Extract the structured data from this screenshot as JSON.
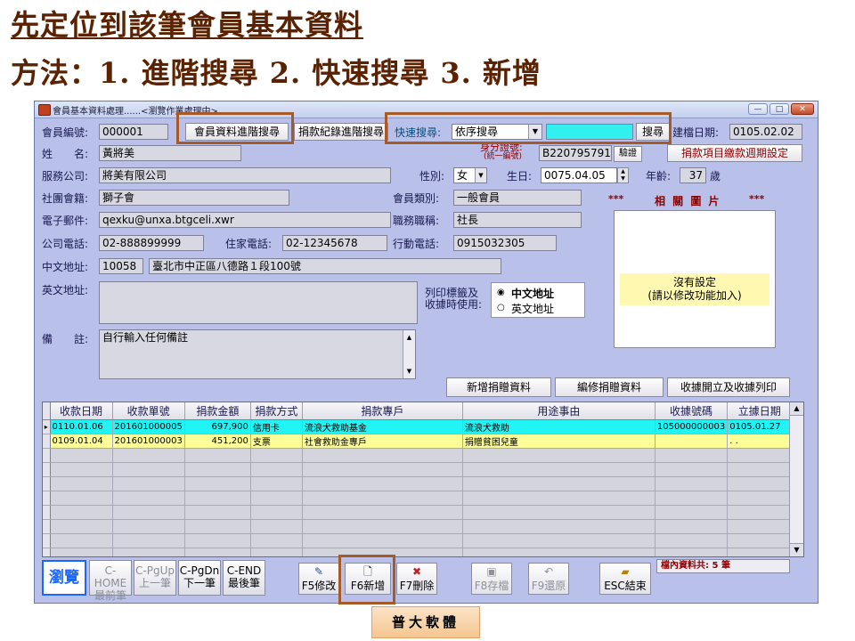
{
  "slide": {
    "title_line1": "先定位到該筆會員基本資料",
    "title_line2": "方法：1. 進階搜尋 2. 快速搜尋 3. 新增",
    "footer_label": "普大軟體"
  },
  "window": {
    "title": "會員基本資料處理......<瀏覽作業處理中>",
    "minimize_glyph": "—",
    "maximize_glyph": "□",
    "close_glyph": "✕"
  },
  "form": {
    "member_no": {
      "label": "會員編號:",
      "value": "000001"
    },
    "advanced_search_button": "會員資料進階搜尋",
    "donation_search_button": "捐款紀錄進階搜尋",
    "quick_search": {
      "label": "快速搜尋:",
      "selected": "依序搜尋",
      "value": "",
      "button": "搜尋"
    },
    "build_date": {
      "label": "建檔日期:",
      "value": "0105.02.02"
    },
    "name": {
      "label": "姓　　名:",
      "value": "黃將美"
    },
    "id_no": {
      "label_line1": "身分證號:",
      "label_line2": "(統一編號)",
      "value": "B220795791",
      "verify_button": "驗證"
    },
    "donation_period_button": "捐款項目繳款週期設定",
    "company": {
      "label": "服務公司:",
      "value": "將美有限公司"
    },
    "gender": {
      "label": "性別:",
      "value": "女"
    },
    "birthday": {
      "label": "生日:",
      "value": "0075.04.05"
    },
    "age": {
      "label": "年齡:",
      "value": "37",
      "unit": "歲"
    },
    "club": {
      "label": "社團會籍:",
      "value": "獅子會"
    },
    "member_type": {
      "label": "會員類別:",
      "value": "一般會員"
    },
    "email": {
      "label": "電子郵件:",
      "value": "qexku@unxa.btgceli.xwr"
    },
    "job_title": {
      "label": "職務職稱:",
      "value": "社長"
    },
    "office_phone": {
      "label": "公司電話:",
      "value": "02-888899999"
    },
    "home_phone": {
      "label": "住家電話:",
      "value": "02-12345678"
    },
    "mobile": {
      "label": "行動電話:",
      "value": "0915032305"
    },
    "cn_address": {
      "label": "中文地址:",
      "zip": "10058",
      "value": "臺北市中正區八德路１段100號"
    },
    "en_address": {
      "label": "英文地址:",
      "value": ""
    },
    "print_label": {
      "line1": "列印標籤及",
      "line2": "收據時使用:",
      "option_cn": "中文地址",
      "option_en": "英文地址",
      "selected": "中文地址"
    },
    "notes": {
      "label": "備　　註:",
      "value": "自行輸入任何備註"
    },
    "photo": {
      "stars": "***",
      "title": "相 關 圖 片",
      "empty_line1": "沒有設定",
      "empty_line2": "(請以修改功能加入)"
    }
  },
  "actions": {
    "add_donation": "新增捐贈資料",
    "edit_donation": "編修捐贈資料",
    "receipt_print": "收據開立及收據列印"
  },
  "table": {
    "columns": [
      "收款日期",
      "收款單號",
      "捐款金額",
      "捐款方式",
      "捐款專戶",
      "用途事由",
      "收據號碼",
      "立據日期"
    ],
    "rows": [
      [
        "0110.01.06",
        "201601000005",
        "697,900",
        "信用卡",
        "流浪犬救助基金",
        "流浪犬救助",
        "105000000003",
        "0105.01.27"
      ],
      [
        "0109.01.04",
        "201601000003",
        "451,200",
        "支票",
        "社會救助金專戶",
        "捐贈貧困兒童",
        "",
        ". ."
      ]
    ],
    "empty_rows": 8,
    "current_row_marker": "▸"
  },
  "toolbar": {
    "browse": "瀏覽",
    "nav": [
      {
        "line1": "C-HOME",
        "line2": "最前筆"
      },
      {
        "line1": "C-PgUp",
        "line2": "上一筆"
      },
      {
        "line1": "C-PgDn",
        "line2": "下一筆"
      },
      {
        "line1": "C-END",
        "line2": "最後筆"
      }
    ],
    "f5": "F5修改",
    "f6": "F6新增",
    "f7": "F7刪除",
    "f8": "F8存檔",
    "f9": "F9還原",
    "esc": "ESC結束",
    "record_count_label": "檔內資料共:",
    "record_count": "5",
    "record_count_unit": "筆"
  },
  "colors": {
    "title_brown": "#5a2200",
    "highlight_box": "#a55a28",
    "window_bg": "#b9c1ea",
    "selected_row": "#21f4f4",
    "second_row": "#ffff99",
    "browse_button": "#1a66ff"
  }
}
